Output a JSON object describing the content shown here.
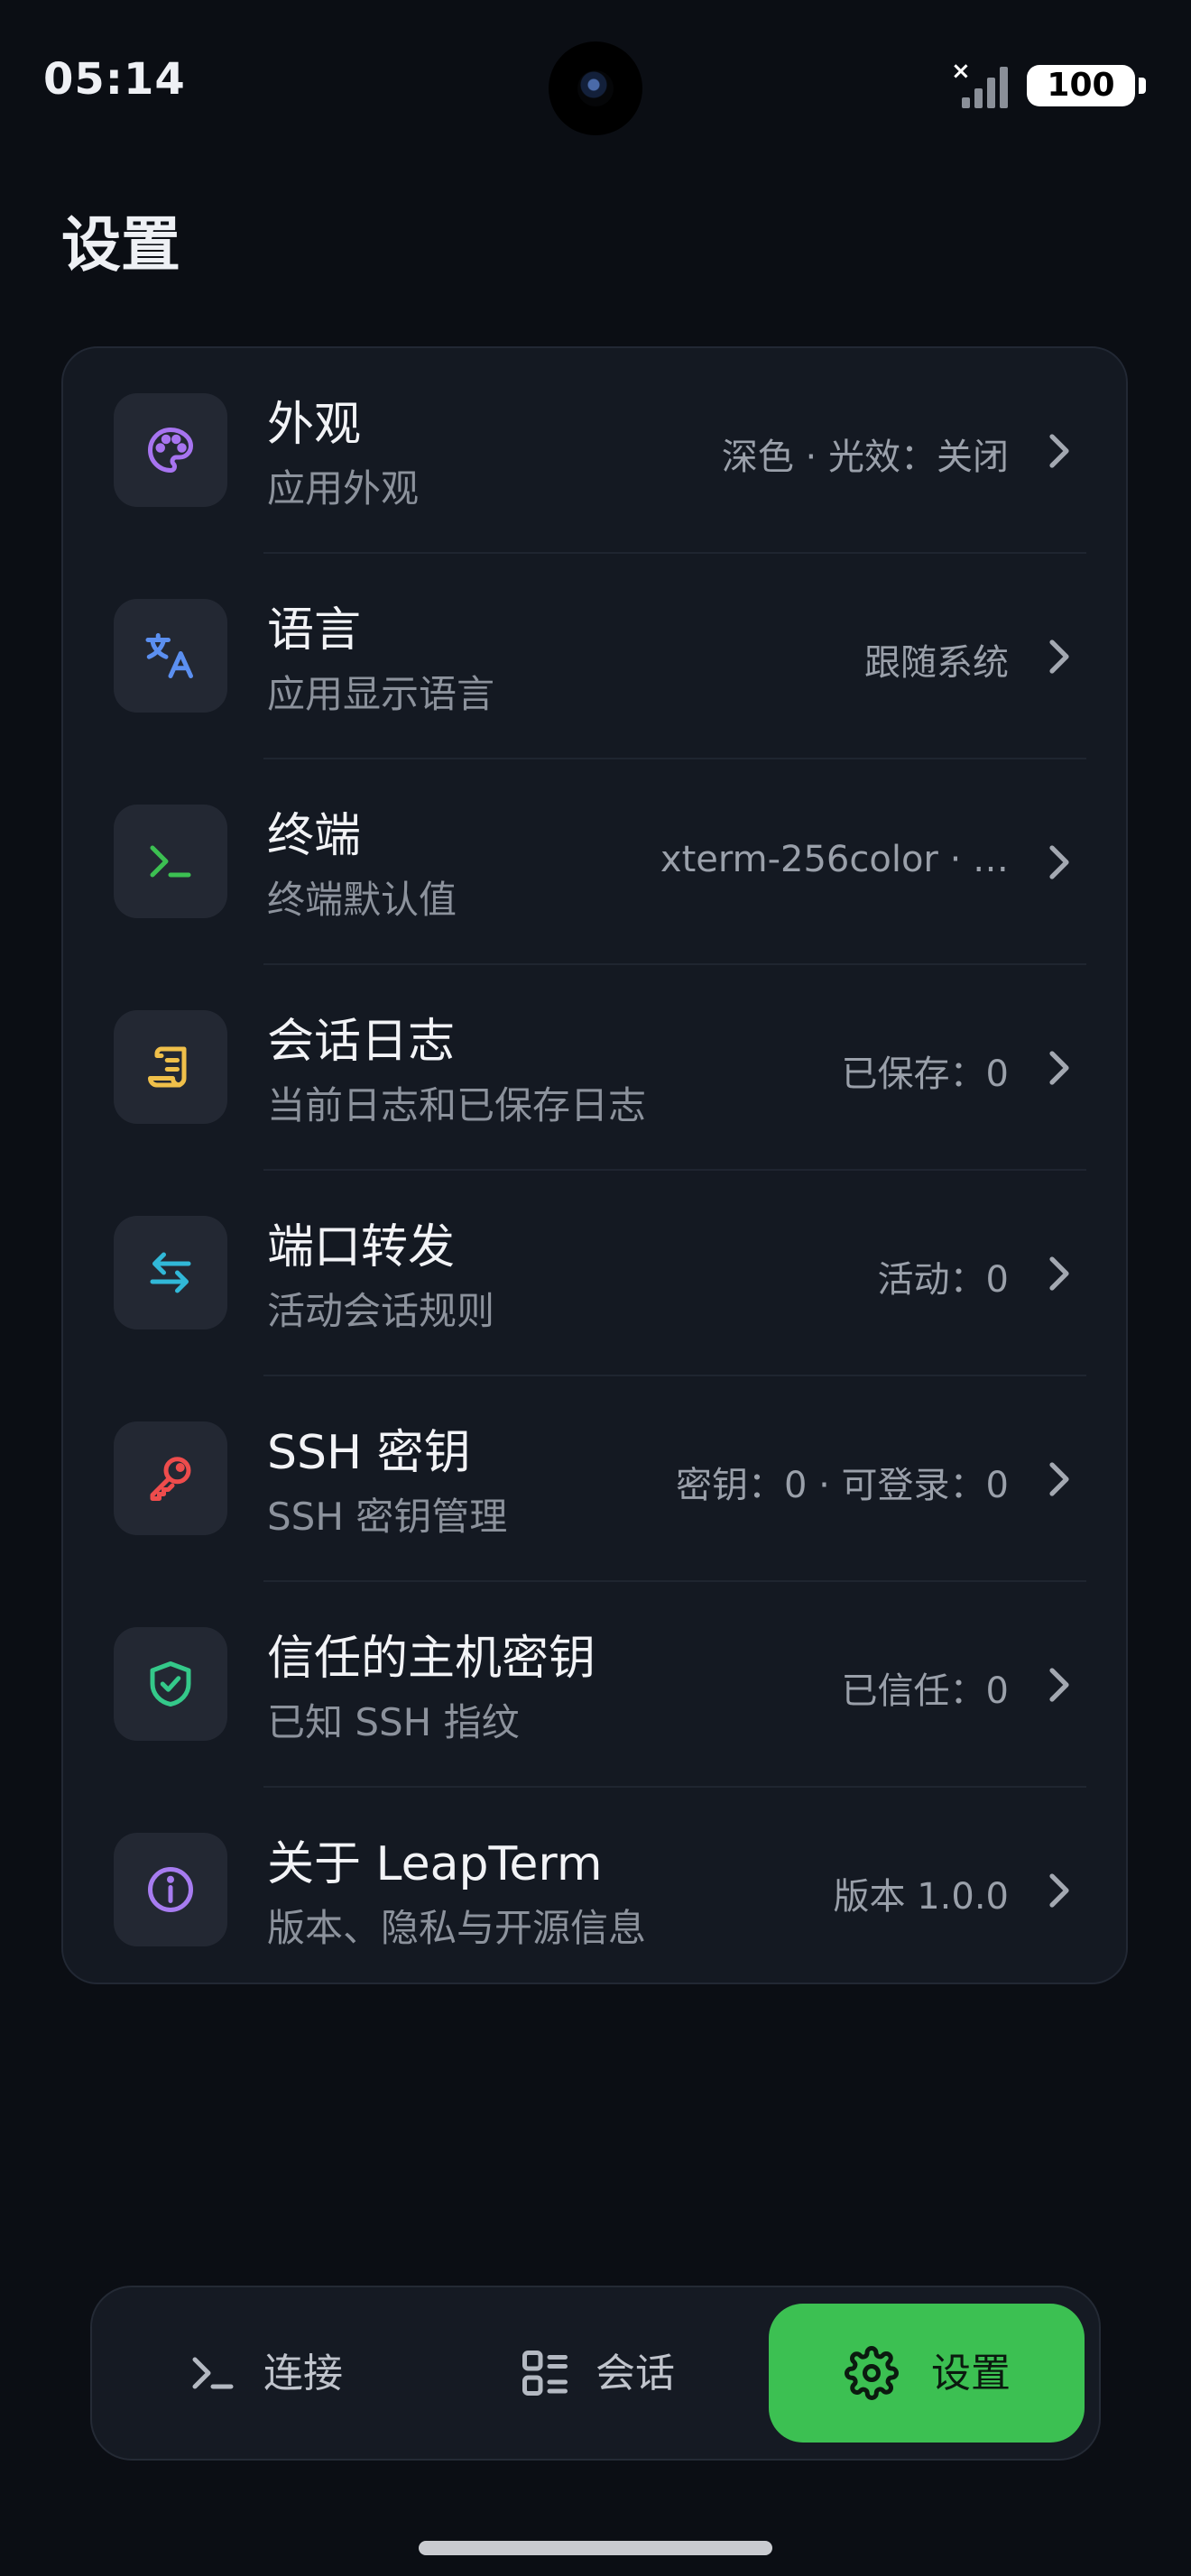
{
  "status_bar": {
    "time": "05:14",
    "battery": "100",
    "signal_off_mark": "×"
  },
  "page": {
    "title": "设置"
  },
  "settings": [
    {
      "icon": "palette-icon",
      "icon_color": "#a774f0",
      "title": "外观",
      "subtitle": "应用外观",
      "value": "深色 · 光效：关闭"
    },
    {
      "icon": "translate-icon",
      "icon_color": "#5b8ff0",
      "title": "语言",
      "subtitle": "应用显示语言",
      "value": "跟随系统"
    },
    {
      "icon": "terminal-icon",
      "icon_color": "#3cc052",
      "title": "终端",
      "subtitle": "终端默认值",
      "value": "xterm-256color · …"
    },
    {
      "icon": "scroll-icon",
      "icon_color": "#f0c04a",
      "title": "会话日志",
      "subtitle": "当前日志和已保存日志",
      "value": "已保存：0"
    },
    {
      "icon": "swap-arrows-icon",
      "icon_color": "#31b8d8",
      "title": "端口转发",
      "subtitle": "活动会话规则",
      "value": "活动：0"
    },
    {
      "icon": "key-icon",
      "icon_color": "#ee4c4c",
      "title": "SSH 密钥",
      "subtitle": "SSH 密钥管理",
      "value": "密钥：0 · 可登录：0"
    },
    {
      "icon": "shield-check-icon",
      "icon_color": "#34c98a",
      "title": "信任的主机密钥",
      "subtitle": "已知 SSH 指纹",
      "value": "已信任：0"
    },
    {
      "icon": "info-icon",
      "icon_color": "#a77cf0",
      "title": "关于 LeapTerm",
      "subtitle": "版本、隐私与开源信息",
      "value": "版本 1.0.0"
    }
  ],
  "nav": {
    "connect_label": "连接",
    "sessions_label": "会话",
    "settings_label": "设置",
    "active_color": "#3cc052"
  }
}
